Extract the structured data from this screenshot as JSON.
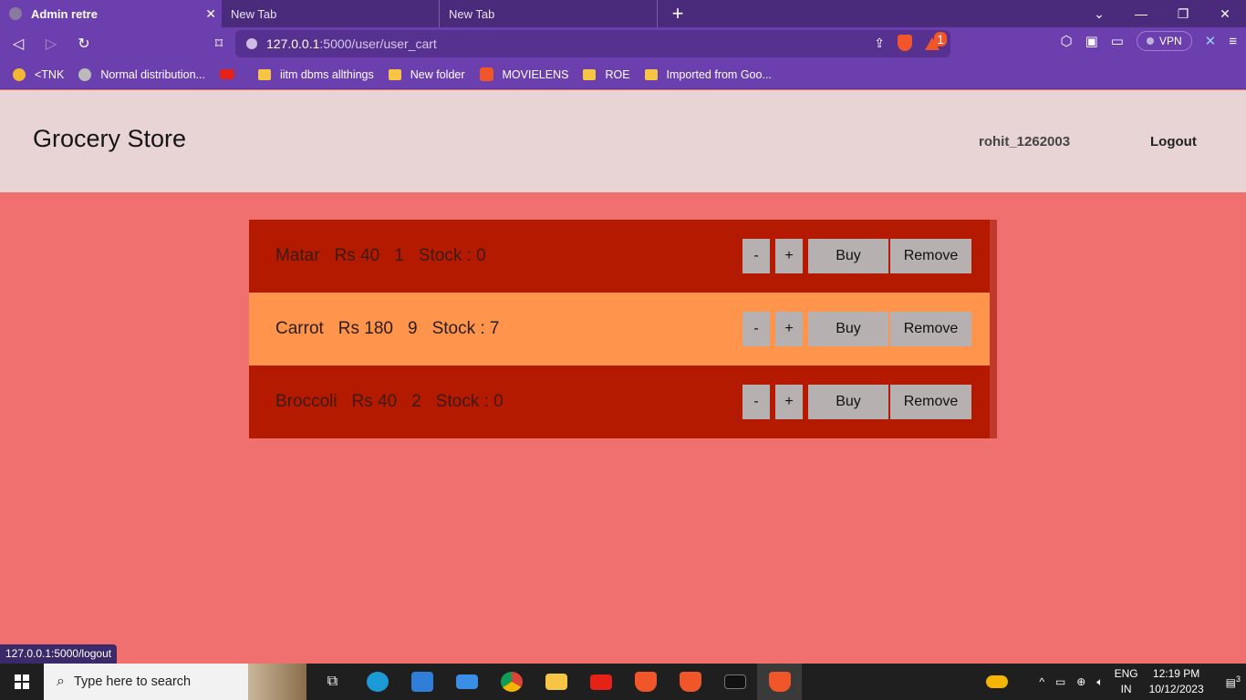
{
  "browser": {
    "tabs": [
      {
        "label": "Admin retre",
        "active": true
      },
      {
        "label": "New Tab",
        "active": false
      },
      {
        "label": "New Tab",
        "active": false
      }
    ],
    "url_host": "127.0.0.1",
    "url_path": ":5000/user/user_cart",
    "reward_count": "1",
    "vpn_label": "VPN",
    "bookmarks": [
      {
        "label": "<TNK",
        "icon": "emoji-icon"
      },
      {
        "label": "Normal distribution...",
        "icon": "site-icon"
      },
      {
        "label": "",
        "icon": "youtube-icon"
      },
      {
        "label": "iitm dbms allthings",
        "icon": "folder-icon"
      },
      {
        "label": "New folder",
        "icon": "folder-icon"
      },
      {
        "label": "MOVIELENS",
        "icon": "m-icon"
      },
      {
        "label": "ROE",
        "icon": "folder-icon"
      },
      {
        "label": "Imported from Goo...",
        "icon": "folder-icon"
      }
    ],
    "status_url": "127.0.0.1:5000/logout"
  },
  "header": {
    "brand": "Grocery Store",
    "username": "rohit_1262003",
    "logout": "Logout"
  },
  "cart": {
    "items": [
      {
        "name": "Matar",
        "price": "Rs 40",
        "qty": "1",
        "stock": "Stock : 0",
        "highlight": false
      },
      {
        "name": "Carrot",
        "price": "Rs 180",
        "qty": "9",
        "stock": "Stock : 7",
        "highlight": true
      },
      {
        "name": "Broccoli",
        "price": "Rs 40",
        "qty": "2",
        "stock": "Stock : 0",
        "highlight": false
      }
    ],
    "buttons": {
      "decrement": "-",
      "increment": "+",
      "buy": "Buy",
      "remove": "Remove"
    }
  },
  "taskbar": {
    "search_placeholder": "Type here to search",
    "lang_top": "ENG",
    "lang_bottom": "IN",
    "time": "12:19 PM",
    "date": "10/12/2023",
    "notification_count": "3"
  },
  "colors": {
    "page_bg": "#f07070",
    "header_bg": "#e8d4d4",
    "row_bg": "#b31a00",
    "row_highlight": "#ff944d",
    "button_bg": "#b6b0b0",
    "browser_accent": "#6b3fae"
  }
}
